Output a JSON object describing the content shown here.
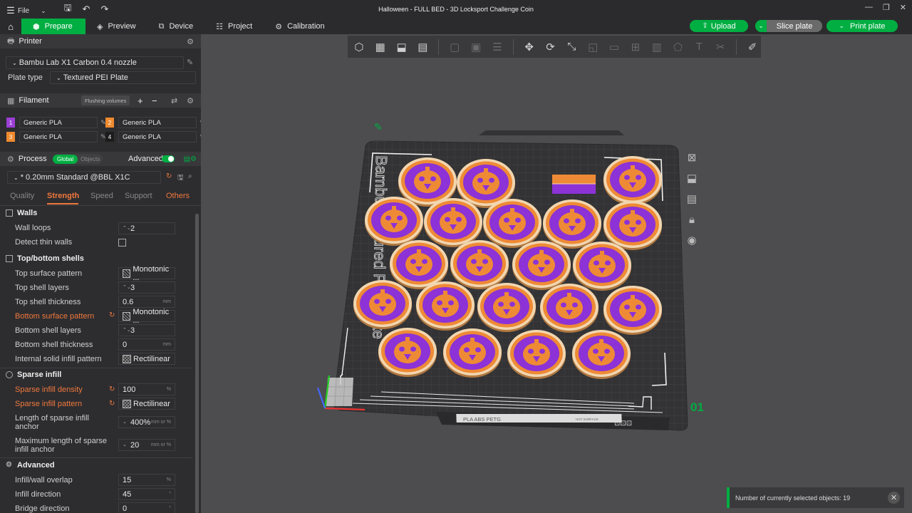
{
  "titlebar": {
    "file_label": "File",
    "window_title": "Halloween - FULL BED - 3D Locksport Challenge Coin"
  },
  "menubar": {
    "tabs": [
      {
        "label": "Prepare",
        "icon": "cube-icon"
      },
      {
        "label": "Preview",
        "icon": "layers-icon"
      },
      {
        "label": "Device",
        "icon": "device-icon"
      },
      {
        "label": "Project",
        "icon": "project-icon"
      },
      {
        "label": "Calibration",
        "icon": "calibration-icon"
      }
    ],
    "upload_label": "Upload",
    "slice_label": "Slice plate",
    "print_label": "Print plate"
  },
  "printer": {
    "section_title": "Printer",
    "printer_name": "Bambu Lab X1 Carbon 0.4 nozzle",
    "plate_type_label": "Plate type",
    "plate_type_value": "Textured PEI Plate"
  },
  "filament": {
    "section_title": "Filament",
    "flushing_label": "Flushing volumes",
    "slots": [
      {
        "num": "1",
        "name": "Generic PLA",
        "color": "#9b3fd6"
      },
      {
        "num": "2",
        "name": "Generic PLA",
        "color": "#f08a2e"
      },
      {
        "num": "3",
        "name": "Generic PLA",
        "color": "#f08a2e"
      },
      {
        "num": "4",
        "name": "Generic PLA",
        "color": "#1c1c1c"
      }
    ]
  },
  "process": {
    "section_title": "Process",
    "toggle_global": "Global",
    "toggle_objects": "Objects",
    "advanced_label": "Advanced",
    "preset": "* 0.20mm Standard @BBL X1C",
    "tabs": [
      "Quality",
      "Strength",
      "Speed",
      "Support",
      "Others"
    ]
  },
  "settings": {
    "walls_title": "Walls",
    "wall_loops_label": "Wall loops",
    "wall_loops_value": "2",
    "detect_thin_label": "Detect thin walls",
    "topbottom_title": "Top/bottom shells",
    "top_pattern_label": "Top surface pattern",
    "top_pattern_value": "Monotonic ...",
    "top_layers_label": "Top shell layers",
    "top_layers_value": "3",
    "top_thickness_label": "Top shell thickness",
    "top_thickness_value": "0.6",
    "bottom_pattern_label": "Bottom surface pattern",
    "bottom_pattern_value": "Monotonic ...",
    "bottom_layers_label": "Bottom shell layers",
    "bottom_layers_value": "3",
    "bottom_thickness_label": "Bottom shell thickness",
    "bottom_thickness_value": "0",
    "internal_pattern_label": "Internal solid infill pattern",
    "internal_pattern_value": "Rectilinear",
    "sparse_title": "Sparse infill",
    "density_label": "Sparse infill density",
    "density_value": "100",
    "sparse_pattern_label": "Sparse infill pattern",
    "sparse_pattern_value": "Rectilinear",
    "anchor_label_1": "Length of sparse infill",
    "anchor_label_2": "anchor",
    "anchor_value": "400%",
    "anchor_unit": "mm or %",
    "max_anchor_label_1": "Maximum length of sparse",
    "max_anchor_label_2": "infill anchor",
    "max_anchor_value": "20",
    "max_anchor_unit": "mm or %",
    "advanced_title": "Advanced",
    "overlap_label": "Infill/wall overlap",
    "overlap_value": "15",
    "infill_dir_label": "Infill direction",
    "infill_dir_value": "45",
    "bridge_dir_label": "Bridge direction",
    "bridge_dir_value": "0",
    "unit_mm": "mm",
    "unit_pct": "%",
    "unit_deg": "°"
  },
  "viewport": {
    "plate_number": "01",
    "plate_label": "PLA ABS PETG",
    "bed_text": "Bambu Textured PEI Plate",
    "hot_surface": "HOT SURFACE",
    "coin_outer_color": "#8c32d6",
    "coin_inner_color": "#ee8a35",
    "coin_rim_color": "#f1d6b0"
  },
  "notification": {
    "text": "Number of currently selected objects: 19"
  }
}
